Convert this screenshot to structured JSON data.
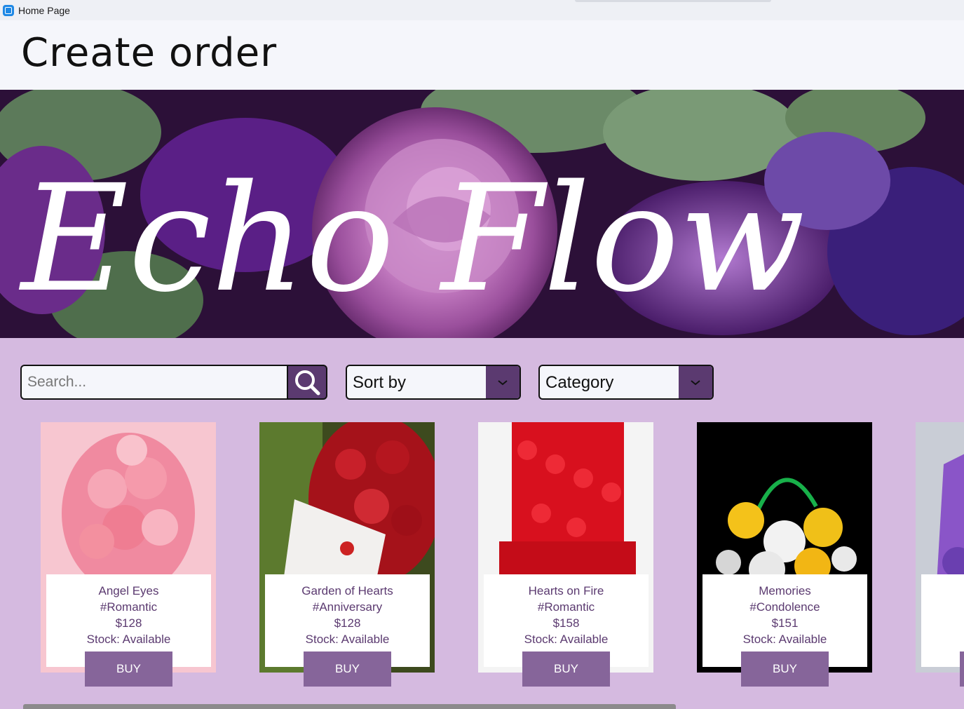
{
  "window": {
    "title": "Home Page"
  },
  "header": {
    "title": "Create order"
  },
  "banner": {
    "text": "Echo Flow"
  },
  "toolbar": {
    "search_placeholder": "Search...",
    "sort_label": "Sort by",
    "category_label": "Category"
  },
  "icons": {
    "app": "app-icon",
    "search": "search-icon",
    "sort_arrow": "chevron-down-icon",
    "category_arrow": "chevron-down-icon"
  },
  "colors": {
    "accent": "#5b3a70",
    "buy_button": "#86659a",
    "page_background": "#d5bae0",
    "card_text": "#5b3a70"
  },
  "products": [
    {
      "name": "Angel Eyes",
      "tag": "#Romantic",
      "price": "$128",
      "stock": "Stock: Available",
      "button": "BUY"
    },
    {
      "name": "Garden of Hearts",
      "tag": "#Anniversary",
      "price": "$128",
      "stock": "Stock: Available",
      "button": "BUY"
    },
    {
      "name": "Hearts on Fire",
      "tag": "#Romantic",
      "price": "$158",
      "stock": "Stock: Available",
      "button": "BUY"
    },
    {
      "name": "Memories",
      "tag": "#Condolence",
      "price": "$151",
      "stock": "Stock: Available",
      "button": "BUY"
    },
    {
      "name": "",
      "tag": "",
      "price": "",
      "stock": "",
      "button": ""
    }
  ]
}
